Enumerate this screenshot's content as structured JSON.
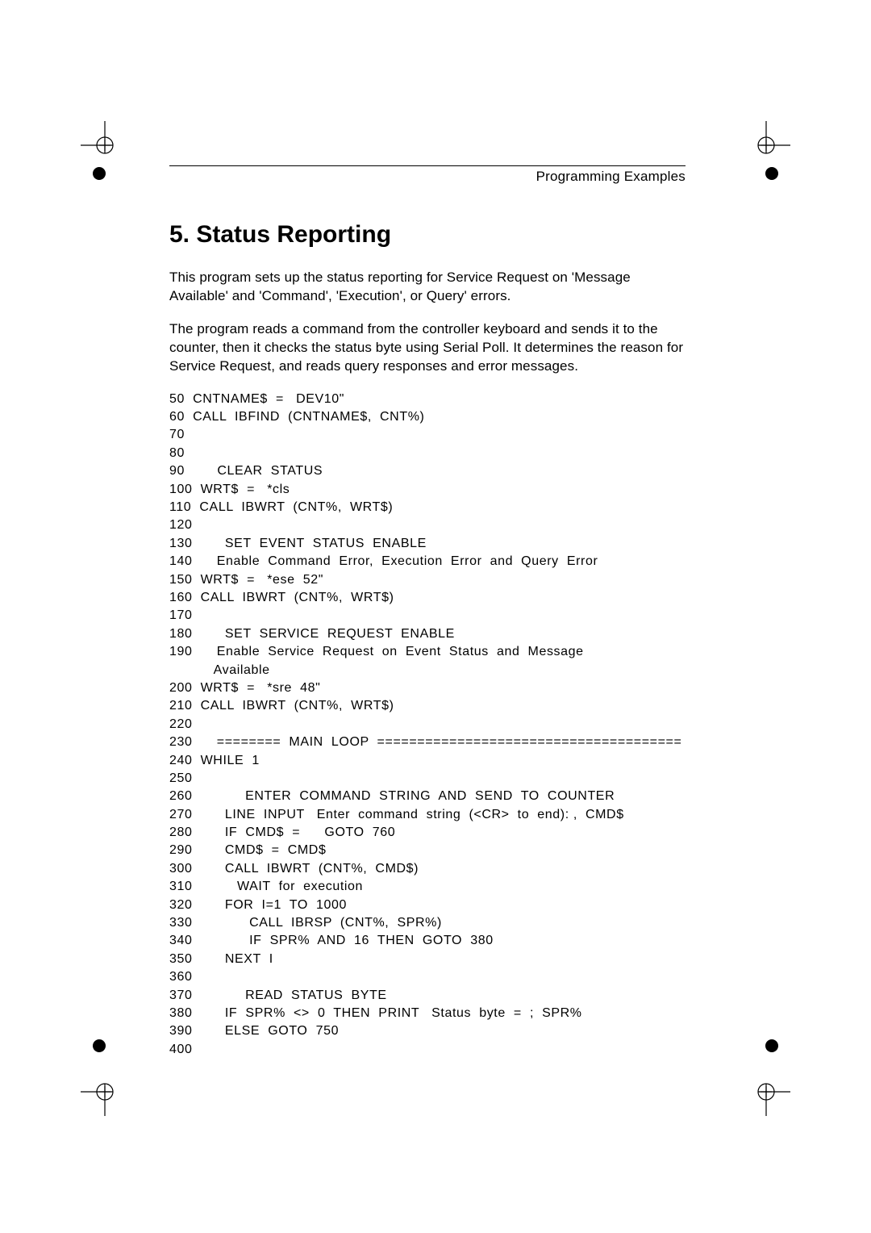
{
  "header": {
    "title": "Programming Examples"
  },
  "heading": "5. Status Reporting",
  "para1": "This program sets up the status reporting for Service Request on 'Message Available' and 'Command', 'Execution', or Query' errors.",
  "para2": "The program reads a command from the controller keyboard and sends it to the counter, then it checks the status byte using Serial Poll. It determines the reason for Service Request, and reads query responses and error messages.",
  "code": "50  CNTNAME$  =   DEV10\"\n60  CALL  IBFIND  (CNTNAME$,  CNT%)\n70\n80\n90        CLEAR  STATUS\n100  WRT$  =   *cls\n110  CALL  IBWRT  (CNT%,  WRT$)\n120\n130        SET  EVENT  STATUS  ENABLE\n140      Enable  Command  Error,  Execution  Error  and  Query  Error\n150  WRT$  =   *ese  52\"\n160  CALL  IBWRT  (CNT%,  WRT$)\n170\n180        SET  SERVICE  REQUEST  ENABLE\n190      Enable  Service  Request  on  Event  Status  and  Message\n           Available\n200  WRT$  =   *sre  48\"\n210  CALL  IBWRT  (CNT%,  WRT$)\n220\n230      ========  MAIN  LOOP  ======================================\n240  WHILE  1\n250\n260             ENTER  COMMAND  STRING  AND  SEND  TO  COUNTER\n270        LINE  INPUT   Enter  command  string  (<CR>  to  end): ,  CMD$\n280        IF  CMD$  =      GOTO  760\n290        CMD$  =  CMD$\n300        CALL  IBWRT  (CNT%,  CMD$)\n310           WAIT  for  execution\n320        FOR  I=1  TO  1000\n330              CALL  IBRSP  (CNT%,  SPR%)\n340              IF  SPR%  AND  16  THEN  GOTO  380\n350        NEXT  I\n360\n370             READ  STATUS  BYTE\n380        IF  SPR%  <>  0  THEN  PRINT   Status  byte  =  ;  SPR%\n390        ELSE  GOTO  750\n400"
}
